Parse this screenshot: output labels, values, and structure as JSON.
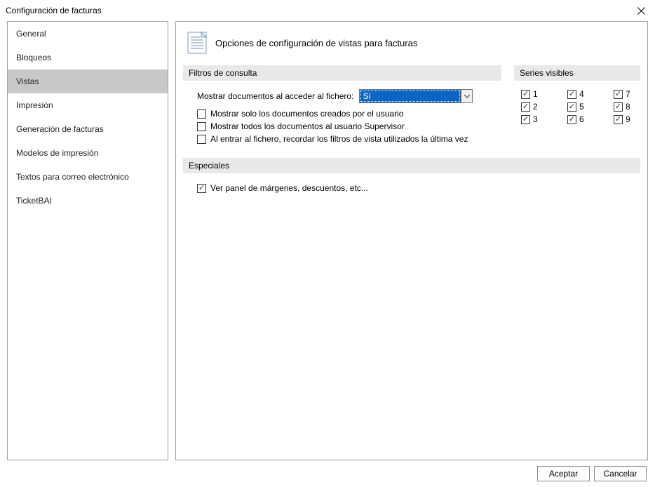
{
  "window": {
    "title": "Configuración de facturas"
  },
  "sidebar": {
    "items": [
      {
        "label": "General"
      },
      {
        "label": "Bloqueos"
      },
      {
        "label": "Vistas",
        "selected": true
      },
      {
        "label": "Impresión"
      },
      {
        "label": "Generación de facturas"
      },
      {
        "label": "Modelos de impresión"
      },
      {
        "label": "Textos para correo electrónico"
      },
      {
        "label": "TicketBAI"
      }
    ]
  },
  "header": {
    "title": "Opciones de configuración de vistas para facturas"
  },
  "sections": {
    "filtros": {
      "title": "Filtros de consulta",
      "show_docs_label": "Mostrar documentos al acceder al fichero:",
      "show_docs_value": "Sí",
      "chk_only_user": {
        "label": "Mostrar solo los documentos creados por el usuario",
        "checked": false
      },
      "chk_all_supervisor": {
        "label": "Mostrar todos los documentos al usuario Supervisor",
        "checked": false
      },
      "chk_remember_filters": {
        "label": "Al entrar al fichero, recordar los filtros de vista utilizados la última vez",
        "checked": false
      }
    },
    "series": {
      "title": "Series visibles",
      "items": [
        {
          "label": "1",
          "checked": true
        },
        {
          "label": "4",
          "checked": true
        },
        {
          "label": "7",
          "checked": true
        },
        {
          "label": "2",
          "checked": true
        },
        {
          "label": "5",
          "checked": true
        },
        {
          "label": "8",
          "checked": true
        },
        {
          "label": "3",
          "checked": true
        },
        {
          "label": "6",
          "checked": true
        },
        {
          "label": "9",
          "checked": true
        }
      ]
    },
    "especiales": {
      "title": "Especiales",
      "chk_panel": {
        "label": "Ver panel de márgenes, descuentos, etc...",
        "checked": true
      }
    }
  },
  "buttons": {
    "ok": "Aceptar",
    "cancel": "Cancelar"
  }
}
